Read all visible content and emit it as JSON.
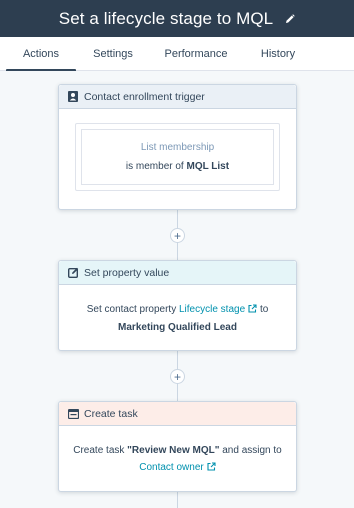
{
  "header": {
    "title": "Set a lifecycle stage to MQL"
  },
  "tabs": [
    {
      "label": "Actions",
      "active": true
    },
    {
      "label": "Settings",
      "active": false
    },
    {
      "label": "Performance",
      "active": false
    },
    {
      "label": "History",
      "active": false
    }
  ],
  "trigger": {
    "title": "Contact enrollment trigger",
    "filter_name": "List membership",
    "filter_prefix": "is member of",
    "filter_value": "MQL List"
  },
  "set_property": {
    "title": "Set property value",
    "prefix": "Set contact property",
    "property": "Lifecycle stage",
    "connector": "to",
    "value": "Marketing Qualified Lead"
  },
  "create_task": {
    "title": "Create task",
    "prefix": "Create task",
    "task_name": "\"Review New MQL\"",
    "middle": "and assign to",
    "assignee": "Contact owner"
  },
  "add_action_symbol": "+",
  "colors": {
    "header_bg": "#2d3e50",
    "trigger_head_bg": "#eaf0f6",
    "action_head_bg": "#e5f5f8",
    "task_head_bg": "#fdede8",
    "link": "#0091ae"
  }
}
